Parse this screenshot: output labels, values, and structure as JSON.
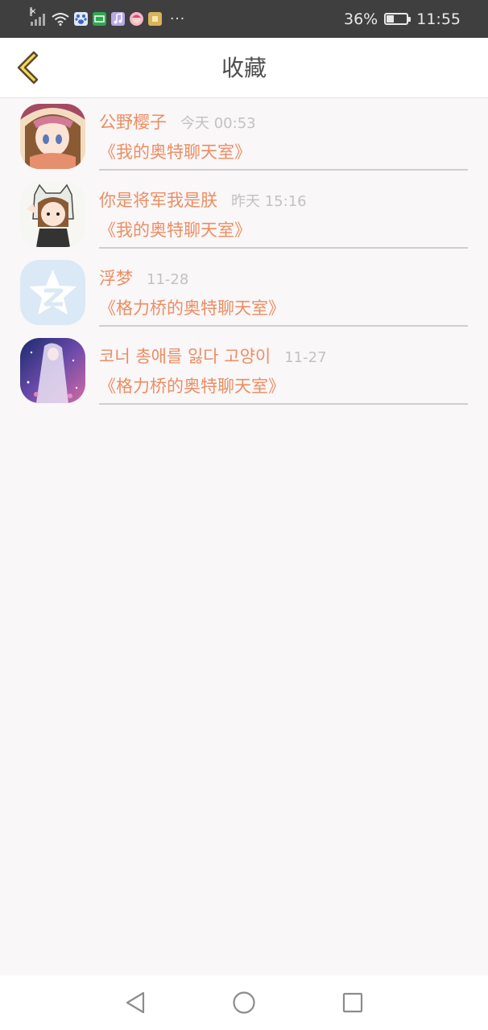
{
  "status_bar": {
    "battery_percent": "36%",
    "battery_level": 0.36,
    "time": "11:55",
    "more": "···",
    "notification_icons": [
      "baidu-paw-icon",
      "green-app-icon",
      "music-icon",
      "pink-avatar-icon",
      "yellow-app-icon"
    ]
  },
  "header": {
    "title": "收藏",
    "back_icon": "chevron-left-icon",
    "colors": {
      "back_fill": "#f7d85a",
      "back_stroke": "#5a4a2a"
    }
  },
  "favorites": [
    {
      "user": "公野樱子",
      "time": "今天 00:53",
      "room": "《我的奥特聊天室》",
      "avatar": "anime-girl-avatar"
    },
    {
      "user": "你是将军我是朕",
      "time": "昨天 15:16",
      "room": "《我的奥特聊天室》",
      "avatar": "cat-hood-girl-avatar"
    },
    {
      "user": "浮梦",
      "time": "11-28",
      "room": "《格力桥的奥特聊天室》",
      "avatar": "qzone-star-avatar"
    },
    {
      "user": "코너 총애를 잃다 고양이",
      "time": "11-27",
      "room": "《格力桥的奥特聊天室》",
      "avatar": "galaxy-girl-avatar"
    }
  ],
  "colors": {
    "accent": "#ed8d62",
    "time_text": "#c2c2c2",
    "divider": "#cfcfcf",
    "background": "#f9f7f8"
  },
  "nav_bar": {
    "icons": [
      "back-triangle-icon",
      "home-circle-icon",
      "recents-square-icon"
    ]
  }
}
